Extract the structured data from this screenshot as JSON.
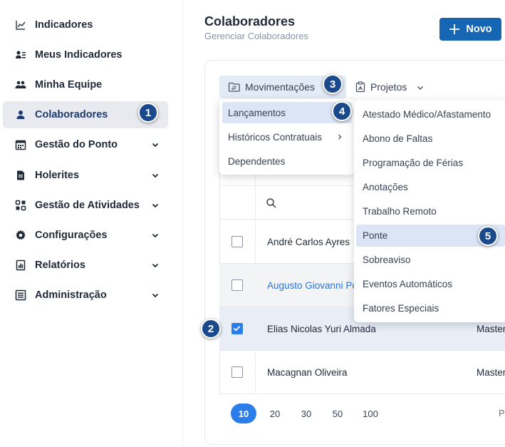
{
  "sidebar": {
    "items": [
      {
        "label": "Indicadores",
        "icon": "chart-line-icon",
        "active": false,
        "chevron": false
      },
      {
        "label": "Meus Indicadores",
        "icon": "user-list-icon",
        "active": false,
        "chevron": false
      },
      {
        "label": "Minha Equipe",
        "icon": "users-icon",
        "active": false,
        "chevron": false
      },
      {
        "label": "Colaboradores",
        "icon": "user-icon",
        "active": true,
        "chevron": false
      },
      {
        "label": "Gestão do Ponto",
        "icon": "calendar-icon",
        "active": false,
        "chevron": true
      },
      {
        "label": "Holerites",
        "icon": "document-icon",
        "active": false,
        "chevron": true
      },
      {
        "label": "Gestão de Atividades",
        "icon": "grid-icon",
        "active": false,
        "chevron": true
      },
      {
        "label": "Configurações",
        "icon": "gear-icon",
        "active": false,
        "chevron": true
      },
      {
        "label": "Relatórios",
        "icon": "report-icon",
        "active": false,
        "chevron": true
      },
      {
        "label": "Administração",
        "icon": "admin-list-icon",
        "active": false,
        "chevron": true
      }
    ]
  },
  "header": {
    "title": "Colaboradores",
    "subtitle": "Gerenciar Colaboradores",
    "new_button": "Novo"
  },
  "tabs": {
    "movimentacoes": "Movimentações",
    "projetos": "Projetos"
  },
  "menu_level1": {
    "items": [
      "Lançamentos",
      "Históricos Contratuais",
      "Dependentes"
    ]
  },
  "menu_level2": {
    "items": [
      "Atestado Médico/Afastamento",
      "Abono de Faltas",
      "Programação de Férias",
      "Anotações",
      "Trabalho Remoto",
      "Ponte",
      "Sobreaviso",
      "Eventos Automáticos",
      "Fatores Especiais"
    ]
  },
  "table": {
    "rows": [
      {
        "name": "André Carlos Ayres",
        "extra": "",
        "checked": false
      },
      {
        "name": "Augusto Giovanni Po",
        "extra": "",
        "checked": false
      },
      {
        "name": "Elias Nicolas Yuri Almada",
        "extra": "Master",
        "checked": true
      },
      {
        "name": "Macagnan Oliveira",
        "extra": "Master",
        "checked": false
      }
    ]
  },
  "pagination": {
    "sizes": [
      "10",
      "20",
      "30",
      "50",
      "100"
    ],
    "selected": "10",
    "trailing": "P"
  },
  "badges": [
    "1",
    "2",
    "3",
    "4",
    "5"
  ],
  "colors": {
    "primary": "#1766b4",
    "accent": "#2b7de9",
    "badge": "#1a4a8c",
    "highlight": "#dbe5f5"
  }
}
